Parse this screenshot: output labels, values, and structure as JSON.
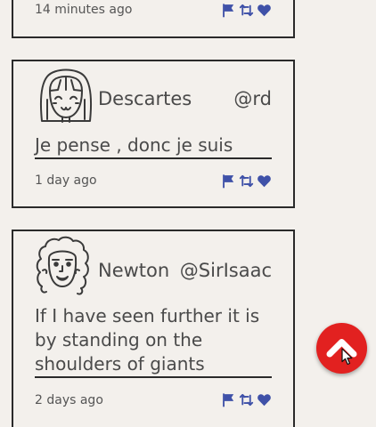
{
  "colors": {
    "action_icon": "#3f51a8",
    "scroll_button": "#e22120",
    "border": "#2a2a2a",
    "background": "#f3f0ec"
  },
  "posts": [
    {
      "timestamp": "14 minutes ago",
      "actions": [
        "flag-icon",
        "retweet-icon",
        "heart-icon"
      ]
    },
    {
      "author": "Descartes",
      "handle": "@rd",
      "text": "Je pense , donc je suis",
      "timestamp": "1 day ago",
      "avatar": "descartes-avatar-icon",
      "actions": [
        "flag-icon",
        "retweet-icon",
        "heart-icon"
      ]
    },
    {
      "author": "Newton",
      "handle": "@SirIsaac",
      "text": "If I have seen further it is by standing on the shoulders of giants",
      "timestamp": "2 days ago",
      "avatar": "newton-avatar-icon",
      "actions": [
        "flag-icon",
        "retweet-icon",
        "heart-icon"
      ]
    }
  ],
  "scroll_top_icon": "chevron-up-icon"
}
